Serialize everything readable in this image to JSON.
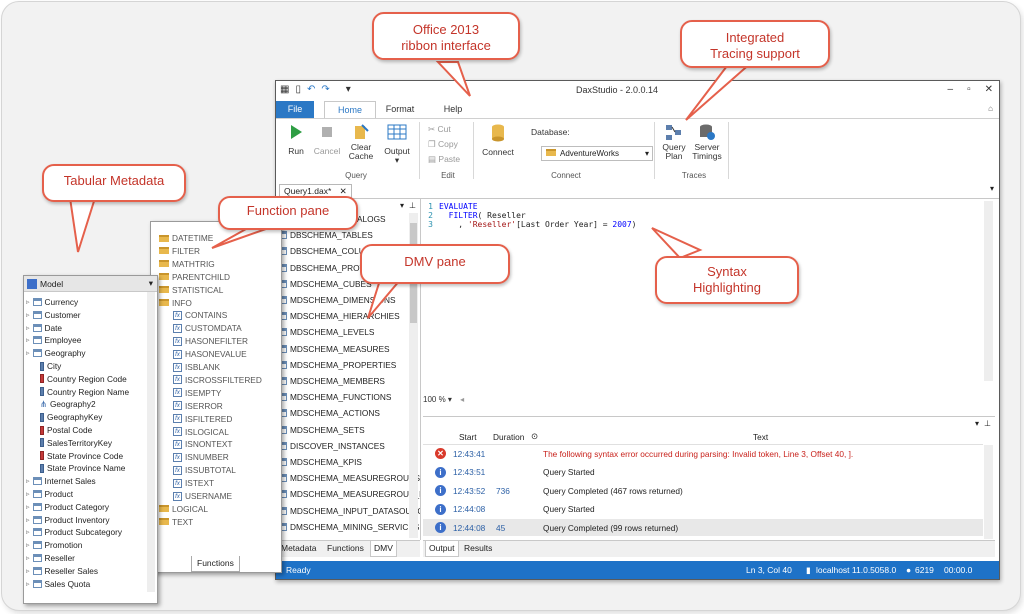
{
  "callouts": {
    "ribbon": [
      "Office 2013",
      "ribbon interface"
    ],
    "tracing": [
      "Integrated",
      "Tracing support"
    ],
    "metadata": "Tabular Metadata",
    "function": "Function pane",
    "dmv": "DMV pane",
    "syntax": [
      "Syntax",
      "Highlighting"
    ]
  },
  "window": {
    "title": "DaxStudio - 2.0.0.14",
    "tabs": [
      "File",
      "Home",
      "Format",
      "Help"
    ],
    "ribbon": {
      "run": "Run",
      "cancel": "Cancel",
      "clear_cache": [
        "Clear",
        "Cache"
      ],
      "output": "Output",
      "query_group": "Query",
      "cut": "Cut",
      "copy": "Copy",
      "paste": "Paste",
      "edit_group": "Edit",
      "connect": "Connect",
      "database_label": "Database:",
      "database_value": "AdventureWorks",
      "connect_group": "Connect",
      "query_plan": [
        "Query",
        "Plan"
      ],
      "server_timings": [
        "Server",
        "Timings"
      ],
      "traces_group": "Traces"
    },
    "doc_tab": "Query1.dax*"
  },
  "dmv": {
    "items": [
      "DBSCHEMA_CATALOGS",
      "DBSCHEMA_TABLES",
      "DBSCHEMA_COLUMNS",
      "DBSCHEMA_PROVIDER_TYPES",
      "MDSCHEMA_CUBES",
      "MDSCHEMA_DIMENSIONS",
      "MDSCHEMA_HIERARCHIES",
      "MDSCHEMA_LEVELS",
      "MDSCHEMA_MEASURES",
      "MDSCHEMA_PROPERTIES",
      "MDSCHEMA_MEMBERS",
      "MDSCHEMA_FUNCTIONS",
      "MDSCHEMA_ACTIONS",
      "MDSCHEMA_SETS",
      "DISCOVER_INSTANCES",
      "MDSCHEMA_KPIS",
      "MDSCHEMA_MEASUREGROUPS",
      "MDSCHEMA_MEASUREGROUP_DIMENSIONS",
      "MDSCHEMA_INPUT_DATASOURCES",
      "DMSCHEMA_MINING_SERVICES"
    ],
    "tabs": [
      "Metadata",
      "Functions",
      "DMV"
    ]
  },
  "editor": {
    "lines": [
      {
        "n": "1",
        "parts": [
          [
            "kw",
            "EVALUATE"
          ]
        ]
      },
      {
        "n": "2",
        "parts": [
          [
            "txt",
            "  "
          ],
          [
            "kw",
            "FILTER"
          ],
          [
            "txt",
            "( Reseller"
          ]
        ]
      },
      {
        "n": "3",
        "parts": [
          [
            "txt",
            "    , "
          ],
          [
            "str",
            "'Reseller'"
          ],
          [
            "txt",
            "[Last Order Year] = "
          ],
          [
            "num",
            "2007"
          ],
          [
            "txt",
            ")"
          ]
        ]
      }
    ],
    "zoom": "100 %"
  },
  "output": {
    "headers": {
      "start": "Start",
      "duration": "Duration",
      "text": "Text"
    },
    "rows": [
      {
        "type": "error",
        "start": "12:43:41",
        "duration": "",
        "text": "The following syntax error occurred during parsing: Invalid token, Line 3, Offset 40, ]."
      },
      {
        "type": "info",
        "start": "12:43:51",
        "duration": "",
        "text": "Query Started"
      },
      {
        "type": "info",
        "start": "12:43:52",
        "duration": "736",
        "text": "Query Completed (467 rows returned)"
      },
      {
        "type": "info",
        "start": "12:44:08",
        "duration": "",
        "text": "Query Started"
      },
      {
        "type": "info",
        "start": "12:44:08",
        "duration": "45",
        "text": "Query Completed (99 rows returned)"
      }
    ],
    "tabs": [
      "Output",
      "Results"
    ]
  },
  "status": {
    "ready": "Ready",
    "position": "Ln 3, Col 40",
    "server": "localhost 11.0.5058.0",
    "spid": "6219",
    "timer": "00:00.0"
  },
  "metadata": {
    "model": "Model",
    "items": [
      {
        "label": "Currency",
        "kind": "table",
        "indent": 0
      },
      {
        "label": "Customer",
        "kind": "table",
        "indent": 0
      },
      {
        "label": "Date",
        "kind": "table",
        "indent": 0
      },
      {
        "label": "Employee",
        "kind": "table",
        "indent": 0
      },
      {
        "label": "Geography",
        "kind": "table",
        "indent": 0
      },
      {
        "label": "City",
        "kind": "col",
        "indent": 1
      },
      {
        "label": "Country Region Code",
        "kind": "colred",
        "indent": 1
      },
      {
        "label": "Country Region Name",
        "kind": "col",
        "indent": 1
      },
      {
        "label": "Geography2",
        "kind": "hier",
        "indent": 1
      },
      {
        "label": "GeographyKey",
        "kind": "col",
        "indent": 1
      },
      {
        "label": "Postal Code",
        "kind": "colred",
        "indent": 1
      },
      {
        "label": "SalesTerritoryKey",
        "kind": "col",
        "indent": 1
      },
      {
        "label": "State Province Code",
        "kind": "colred",
        "indent": 1
      },
      {
        "label": "State Province Name",
        "kind": "col",
        "indent": 1
      },
      {
        "label": "Internet Sales",
        "kind": "table",
        "indent": 0
      },
      {
        "label": "Product",
        "kind": "table",
        "indent": 0
      },
      {
        "label": "Product Category",
        "kind": "table",
        "indent": 0
      },
      {
        "label": "Product Inventory",
        "kind": "table",
        "indent": 0
      },
      {
        "label": "Product Subcategory",
        "kind": "table",
        "indent": 0
      },
      {
        "label": "Promotion",
        "kind": "table",
        "indent": 0
      },
      {
        "label": "Reseller",
        "kind": "table",
        "indent": 0
      },
      {
        "label": "Reseller Sales",
        "kind": "table",
        "indent": 0
      },
      {
        "label": "Sales Quota",
        "kind": "table",
        "indent": 0
      }
    ]
  },
  "functions": {
    "items": [
      {
        "label": "DATETIME",
        "kind": "folder",
        "indent": 0
      },
      {
        "label": "FILTER",
        "kind": "folder",
        "indent": 0
      },
      {
        "label": "MATHTRIG",
        "kind": "folder",
        "indent": 0
      },
      {
        "label": "PARENTCHILD",
        "kind": "folder",
        "indent": 0
      },
      {
        "label": "STATISTICAL",
        "kind": "folder",
        "indent": 0
      },
      {
        "label": "INFO",
        "kind": "folder",
        "indent": 0
      },
      {
        "label": "CONTAINS",
        "kind": "fn",
        "indent": 1
      },
      {
        "label": "CUSTOMDATA",
        "kind": "fn",
        "indent": 1
      },
      {
        "label": "HASONEFILTER",
        "kind": "fn",
        "indent": 1
      },
      {
        "label": "HASONEVALUE",
        "kind": "fn",
        "indent": 1
      },
      {
        "label": "ISBLANK",
        "kind": "fn",
        "indent": 1
      },
      {
        "label": "ISCROSSFILTERED",
        "kind": "fn",
        "indent": 1
      },
      {
        "label": "ISEMPTY",
        "kind": "fn",
        "indent": 1
      },
      {
        "label": "ISERROR",
        "kind": "fn",
        "indent": 1
      },
      {
        "label": "ISFILTERED",
        "kind": "fn",
        "indent": 1
      },
      {
        "label": "ISLOGICAL",
        "kind": "fn",
        "indent": 1
      },
      {
        "label": "ISNONTEXT",
        "kind": "fn",
        "indent": 1
      },
      {
        "label": "ISNUMBER",
        "kind": "fn",
        "indent": 1
      },
      {
        "label": "ISSUBTOTAL",
        "kind": "fn",
        "indent": 1
      },
      {
        "label": "ISTEXT",
        "kind": "fn",
        "indent": 1
      },
      {
        "label": "USERNAME",
        "kind": "fn",
        "indent": 1
      },
      {
        "label": "LOGICAL",
        "kind": "folder",
        "indent": 0
      },
      {
        "label": "TEXT",
        "kind": "folder",
        "indent": 0
      }
    ],
    "tab": "Functions"
  }
}
